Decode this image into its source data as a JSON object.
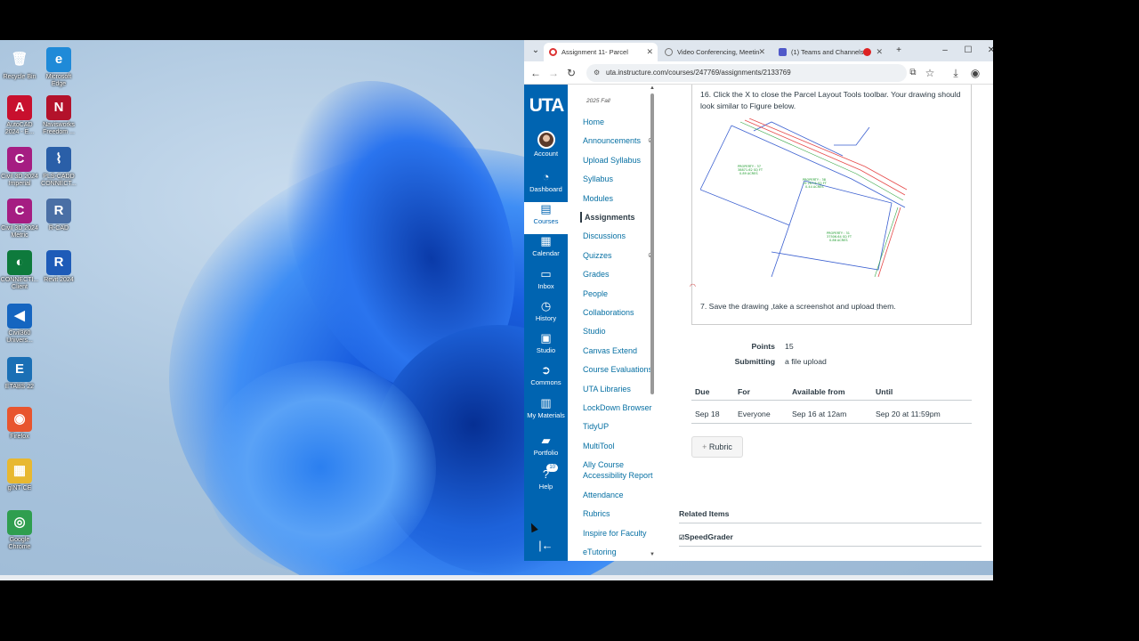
{
  "desktop": {
    "icons": [
      {
        "label": "Recycle Bin",
        "glyph": "🗑",
        "color": "transparent"
      },
      {
        "label": "Microsoft\nEdge",
        "glyph": "e",
        "color": "#1f8ad8"
      },
      {
        "label": "AutoCAD\n2024 - E...",
        "glyph": "A",
        "color": "#c8102e"
      },
      {
        "label": "Navisworks\nFreedom ...",
        "glyph": "N",
        "color": "#b3122b"
      },
      {
        "label": "Civil 3D 2024\nImperial",
        "glyph": "C",
        "color": "#a51d82"
      },
      {
        "label": "PLS-CADD\nCONNECT...",
        "glyph": "⌇",
        "color": "#2a5fa8"
      },
      {
        "label": "Civil 3D 2024\nMetric",
        "glyph": "C",
        "color": "#a51d82"
      },
      {
        "label": "R-CAD",
        "glyph": "R",
        "color": "#4a6fa5"
      },
      {
        "label": "CONNECTI...\nClient",
        "glyph": "◐",
        "color": "#0e7a3c"
      },
      {
        "label": "Revit 2024",
        "glyph": "R",
        "color": "#1e5bb8"
      },
      {
        "label": "Civil360\nUnivers...",
        "glyph": "◀",
        "color": "#1565c0"
      },
      {
        "label": "ETABS 22",
        "glyph": "E",
        "color": "#1a6fb5"
      },
      {
        "label": "Firefox",
        "glyph": "◉",
        "color": "#e8552e"
      },
      {
        "label": "gINT CE",
        "glyph": "▦",
        "color": "#e8b830"
      },
      {
        "label": "Google\nChrome",
        "glyph": "◎",
        "color": "#2f9e4f"
      }
    ]
  },
  "browser": {
    "tabs": [
      {
        "title": "Assignment 11- Parcel",
        "active": true,
        "icon_color": "#d33"
      },
      {
        "title": "Video Conferencing, Meetin",
        "active": false,
        "icon_color": "#777"
      },
      {
        "title": "(1) Teams and Channels",
        "active": false,
        "icon_color": "#5059c9"
      }
    ],
    "url": "uta.instructure.com/courses/247769/assignments/2133769"
  },
  "global_nav": {
    "logo": "UTA",
    "items": [
      {
        "label": "Account",
        "icon": "avatar-icon"
      },
      {
        "label": "Dashboard",
        "icon": "dashboard-icon",
        "glyph": "◔"
      },
      {
        "label": "Courses",
        "icon": "courses-icon",
        "glyph": "▤",
        "active": true
      },
      {
        "label": "Calendar",
        "icon": "calendar-icon",
        "glyph": "▦"
      },
      {
        "label": "Inbox",
        "icon": "inbox-icon",
        "glyph": "▭"
      },
      {
        "label": "History",
        "icon": "history-icon",
        "glyph": "◷"
      },
      {
        "label": "Studio",
        "icon": "studio-icon",
        "glyph": "▣"
      },
      {
        "label": "Commons",
        "icon": "commons-icon",
        "glyph": "➲"
      },
      {
        "label": "My Materials",
        "icon": "materials-icon",
        "glyph": "▥"
      },
      {
        "label": "Portfolio",
        "icon": "portfolio-icon",
        "glyph": "▰"
      },
      {
        "label": "Help",
        "icon": "help-icon",
        "glyph": "?",
        "badge": "10"
      }
    ],
    "collapse_glyph": "|←"
  },
  "course_nav": {
    "term": "2025 Fall",
    "items": [
      {
        "label": "Home"
      },
      {
        "label": "Announcements",
        "hidden": true
      },
      {
        "label": "Upload Syllabus"
      },
      {
        "label": "Syllabus"
      },
      {
        "label": "Modules"
      },
      {
        "label": "Assignments",
        "active": true
      },
      {
        "label": "Discussions"
      },
      {
        "label": "Quizzes",
        "hidden": true
      },
      {
        "label": "Grades"
      },
      {
        "label": "People"
      },
      {
        "label": "Collaborations"
      },
      {
        "label": "Studio"
      },
      {
        "label": "Canvas Extend"
      },
      {
        "label": "Course Evaluations"
      },
      {
        "label": "UTA Libraries"
      },
      {
        "label": "LockDown Browser"
      },
      {
        "label": "TidyUP"
      },
      {
        "label": "MultiTool"
      },
      {
        "label": "Ally Course\nAccessibility Report"
      },
      {
        "label": "Attendance"
      },
      {
        "label": "Rubrics"
      },
      {
        "label": "Inspire for Faculty"
      },
      {
        "label": "eTutoring"
      }
    ]
  },
  "assignment": {
    "step16": "16. Click the X to close the Parcel Layout Tools toolbar. Your drawing should look similar to Figure below.",
    "step7": "7. Save the drawing ,take a screenshot and upload them.",
    "points_label": "Points",
    "points_value": "15",
    "submitting_label": "Submitting",
    "submitting_value": "a file upload",
    "table": {
      "headers": [
        "Due",
        "For",
        "Available from",
        "Until"
      ],
      "row": [
        "Sep 18",
        "Everyone",
        "Sep 16 at 12am",
        "Sep 20 at 11:59pm"
      ]
    },
    "rubric_label": "Rubric",
    "related_heading": "Related Items",
    "speedgrader_label": "SpeedGrader"
  }
}
